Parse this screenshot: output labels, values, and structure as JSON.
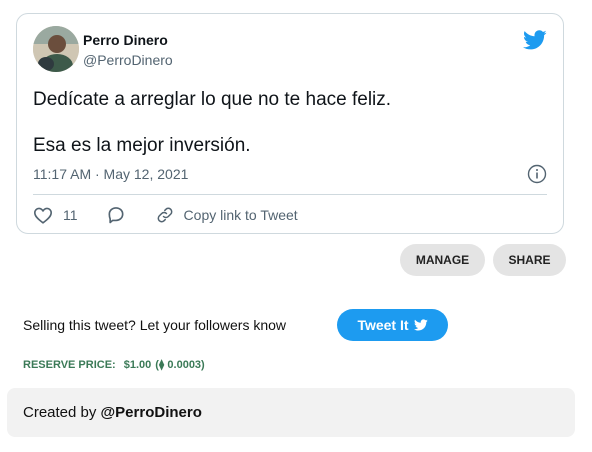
{
  "tweet": {
    "author_name": "Perro Dinero",
    "author_handle": "@PerroDinero",
    "lines": [
      "Dedícate a arreglar lo que no te hace feliz.",
      "Esa es la mejor inversión."
    ],
    "timestamp": "11:17 AM · May 12, 2021",
    "like_count": "11",
    "copy_link_label": "Copy link to Tweet"
  },
  "buttons": {
    "manage": "MANAGE",
    "share": "SHARE"
  },
  "sell": {
    "prompt": "Selling this tweet? Let your followers know",
    "tweet_it_label": "Tweet It"
  },
  "reserve": {
    "label": "RESERVE PRICE:",
    "price": "$1.00",
    "eth": "(⧫ 0.0003)"
  },
  "created": {
    "prefix": "Created by",
    "handle": "@PerroDinero"
  },
  "colors": {
    "accent": "#1d9bf0",
    "reserve_text": "#3b7a57",
    "muted_text": "#536471"
  },
  "icons": [
    "twitter-bird-icon",
    "info-icon",
    "heart-icon",
    "reply-icon",
    "link-icon"
  ]
}
